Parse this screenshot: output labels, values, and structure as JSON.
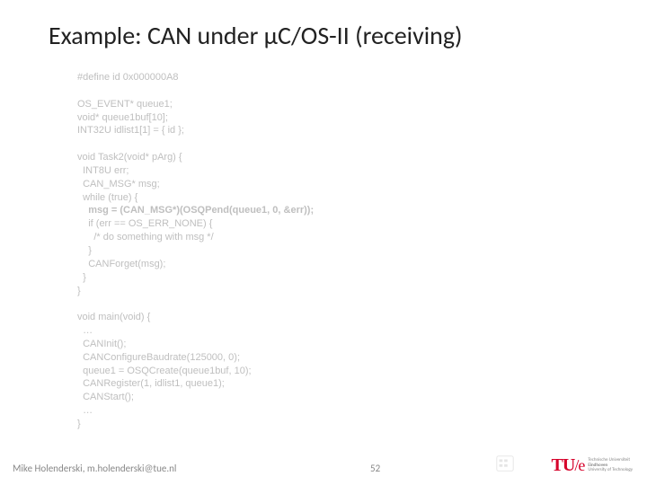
{
  "title": "Example: CAN under μC/OS-II (receiving)",
  "code": {
    "l01": "#define id 0x000000A8",
    "l02": "",
    "l03": "OS_EVENT* queue1;",
    "l04": "void* queue1buf[10];",
    "l05": "INT32U idlist1[1] = { id };",
    "l06": "",
    "l07": "void Task2(void* pArg) {",
    "l08": "  INT8U err;",
    "l09": "  CAN_MSG* msg;",
    "l10": "  while (true) {",
    "l11": "    msg = (CAN_MSG*)(OSQPend(queue1, 0, &err));",
    "l12": "    if (err == OS_ERR_NONE) {",
    "l13": "      /* do something with msg */",
    "l14": "    }",
    "l15": "    CANForget(msg);",
    "l16": "  }",
    "l17": "}",
    "l18": "",
    "l19": "void main(void) {",
    "l20": "  …",
    "l21": "  CANInit();",
    "l22": "  CANConfigureBaudrate(125000, 0);",
    "l23": "  queue1 = OSQCreate(queue1buf, 10);",
    "l24": "  CANRegister(1, idlist1, queue1);",
    "l25": "  CANStart();",
    "l26": "  …",
    "l27": "}"
  },
  "footer": {
    "author": "Mike Holenderski, m.holenderski@tue.nl",
    "page": "52",
    "tue_mark": "TU",
    "tue_e": "/e",
    "tue_sub1": "Technische Universiteit",
    "tue_sub2": "Eindhoven",
    "tue_sub3": "University of Technology"
  }
}
